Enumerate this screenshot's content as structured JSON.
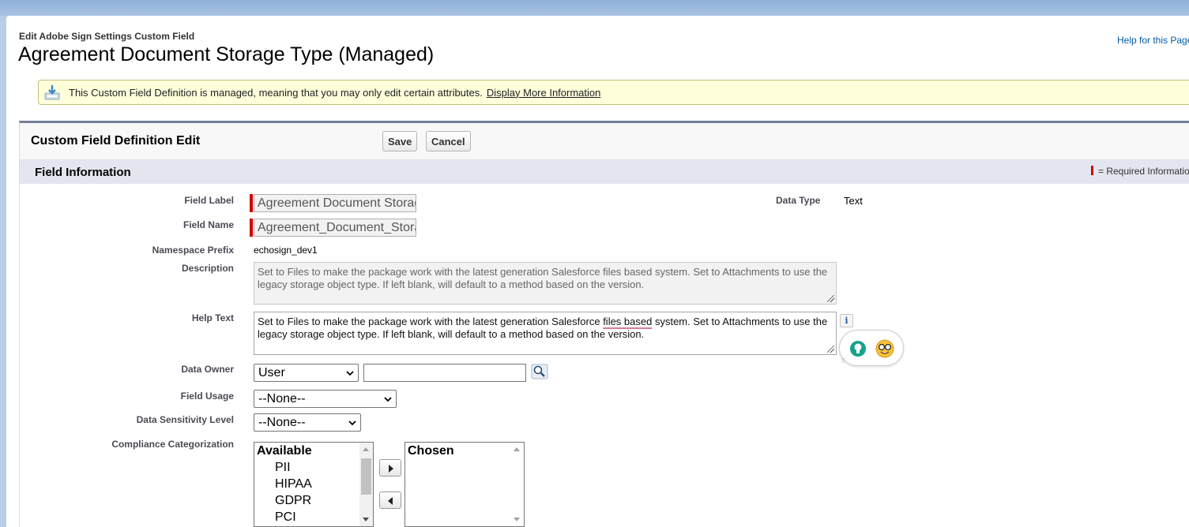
{
  "header": {
    "breadcrumb": "Edit Adobe Sign Settings Custom Field",
    "title": "Agreement Document Storage Type (Managed)",
    "help_link": "Help for this Page"
  },
  "banner": {
    "message": "This Custom Field Definition is managed, meaning that you may only edit certain attributes.",
    "link": "Display More Information",
    "icon": "download-icon"
  },
  "panel": {
    "title": "Custom Field Definition Edit",
    "save_label": "Save",
    "cancel_label": "Cancel"
  },
  "section": {
    "title": "Field Information",
    "required_legend": "= Required Information"
  },
  "fields": {
    "field_label": {
      "label": "Field Label",
      "value": "Agreement Document Storage Type"
    },
    "field_name": {
      "label": "Field Name",
      "value": "Agreement_Document_Storage_Type"
    },
    "namespace_prefix": {
      "label": "Namespace Prefix",
      "value": "echosign_dev1"
    },
    "description": {
      "label": "Description",
      "value": "Set to Files to make the package work with the latest generation Salesforce files based system. Set to Attachments to use the legacy storage object type. If left blank, will default to a method based on the version."
    },
    "help_text": {
      "label": "Help Text",
      "value_part1": "Set to Files to make the package work with the latest generation Salesforce ",
      "value_underlined": "files based",
      "value_part2": " system. Set to Attachments to use the legacy storage object type. If left blank, will default to a method based on the version."
    },
    "data_type": {
      "label": "Data Type",
      "value": "Text"
    },
    "data_owner": {
      "label": "Data Owner",
      "selected": "User",
      "input_value": ""
    },
    "field_usage": {
      "label": "Field Usage",
      "selected": "--None--"
    },
    "data_sensitivity": {
      "label": "Data Sensitivity Level",
      "selected": "--None--"
    },
    "compliance": {
      "label": "Compliance Categorization",
      "available_header": "Available",
      "available_items": [
        "PII",
        "HIPAA",
        "GDPR",
        "PCI"
      ],
      "chosen_header": "Chosen",
      "chosen_items": []
    }
  },
  "colors": {
    "required": "#cc0000",
    "link": "#015ba7",
    "banner_bg": "#ffffdc",
    "section_bg": "#e3e6ef"
  }
}
